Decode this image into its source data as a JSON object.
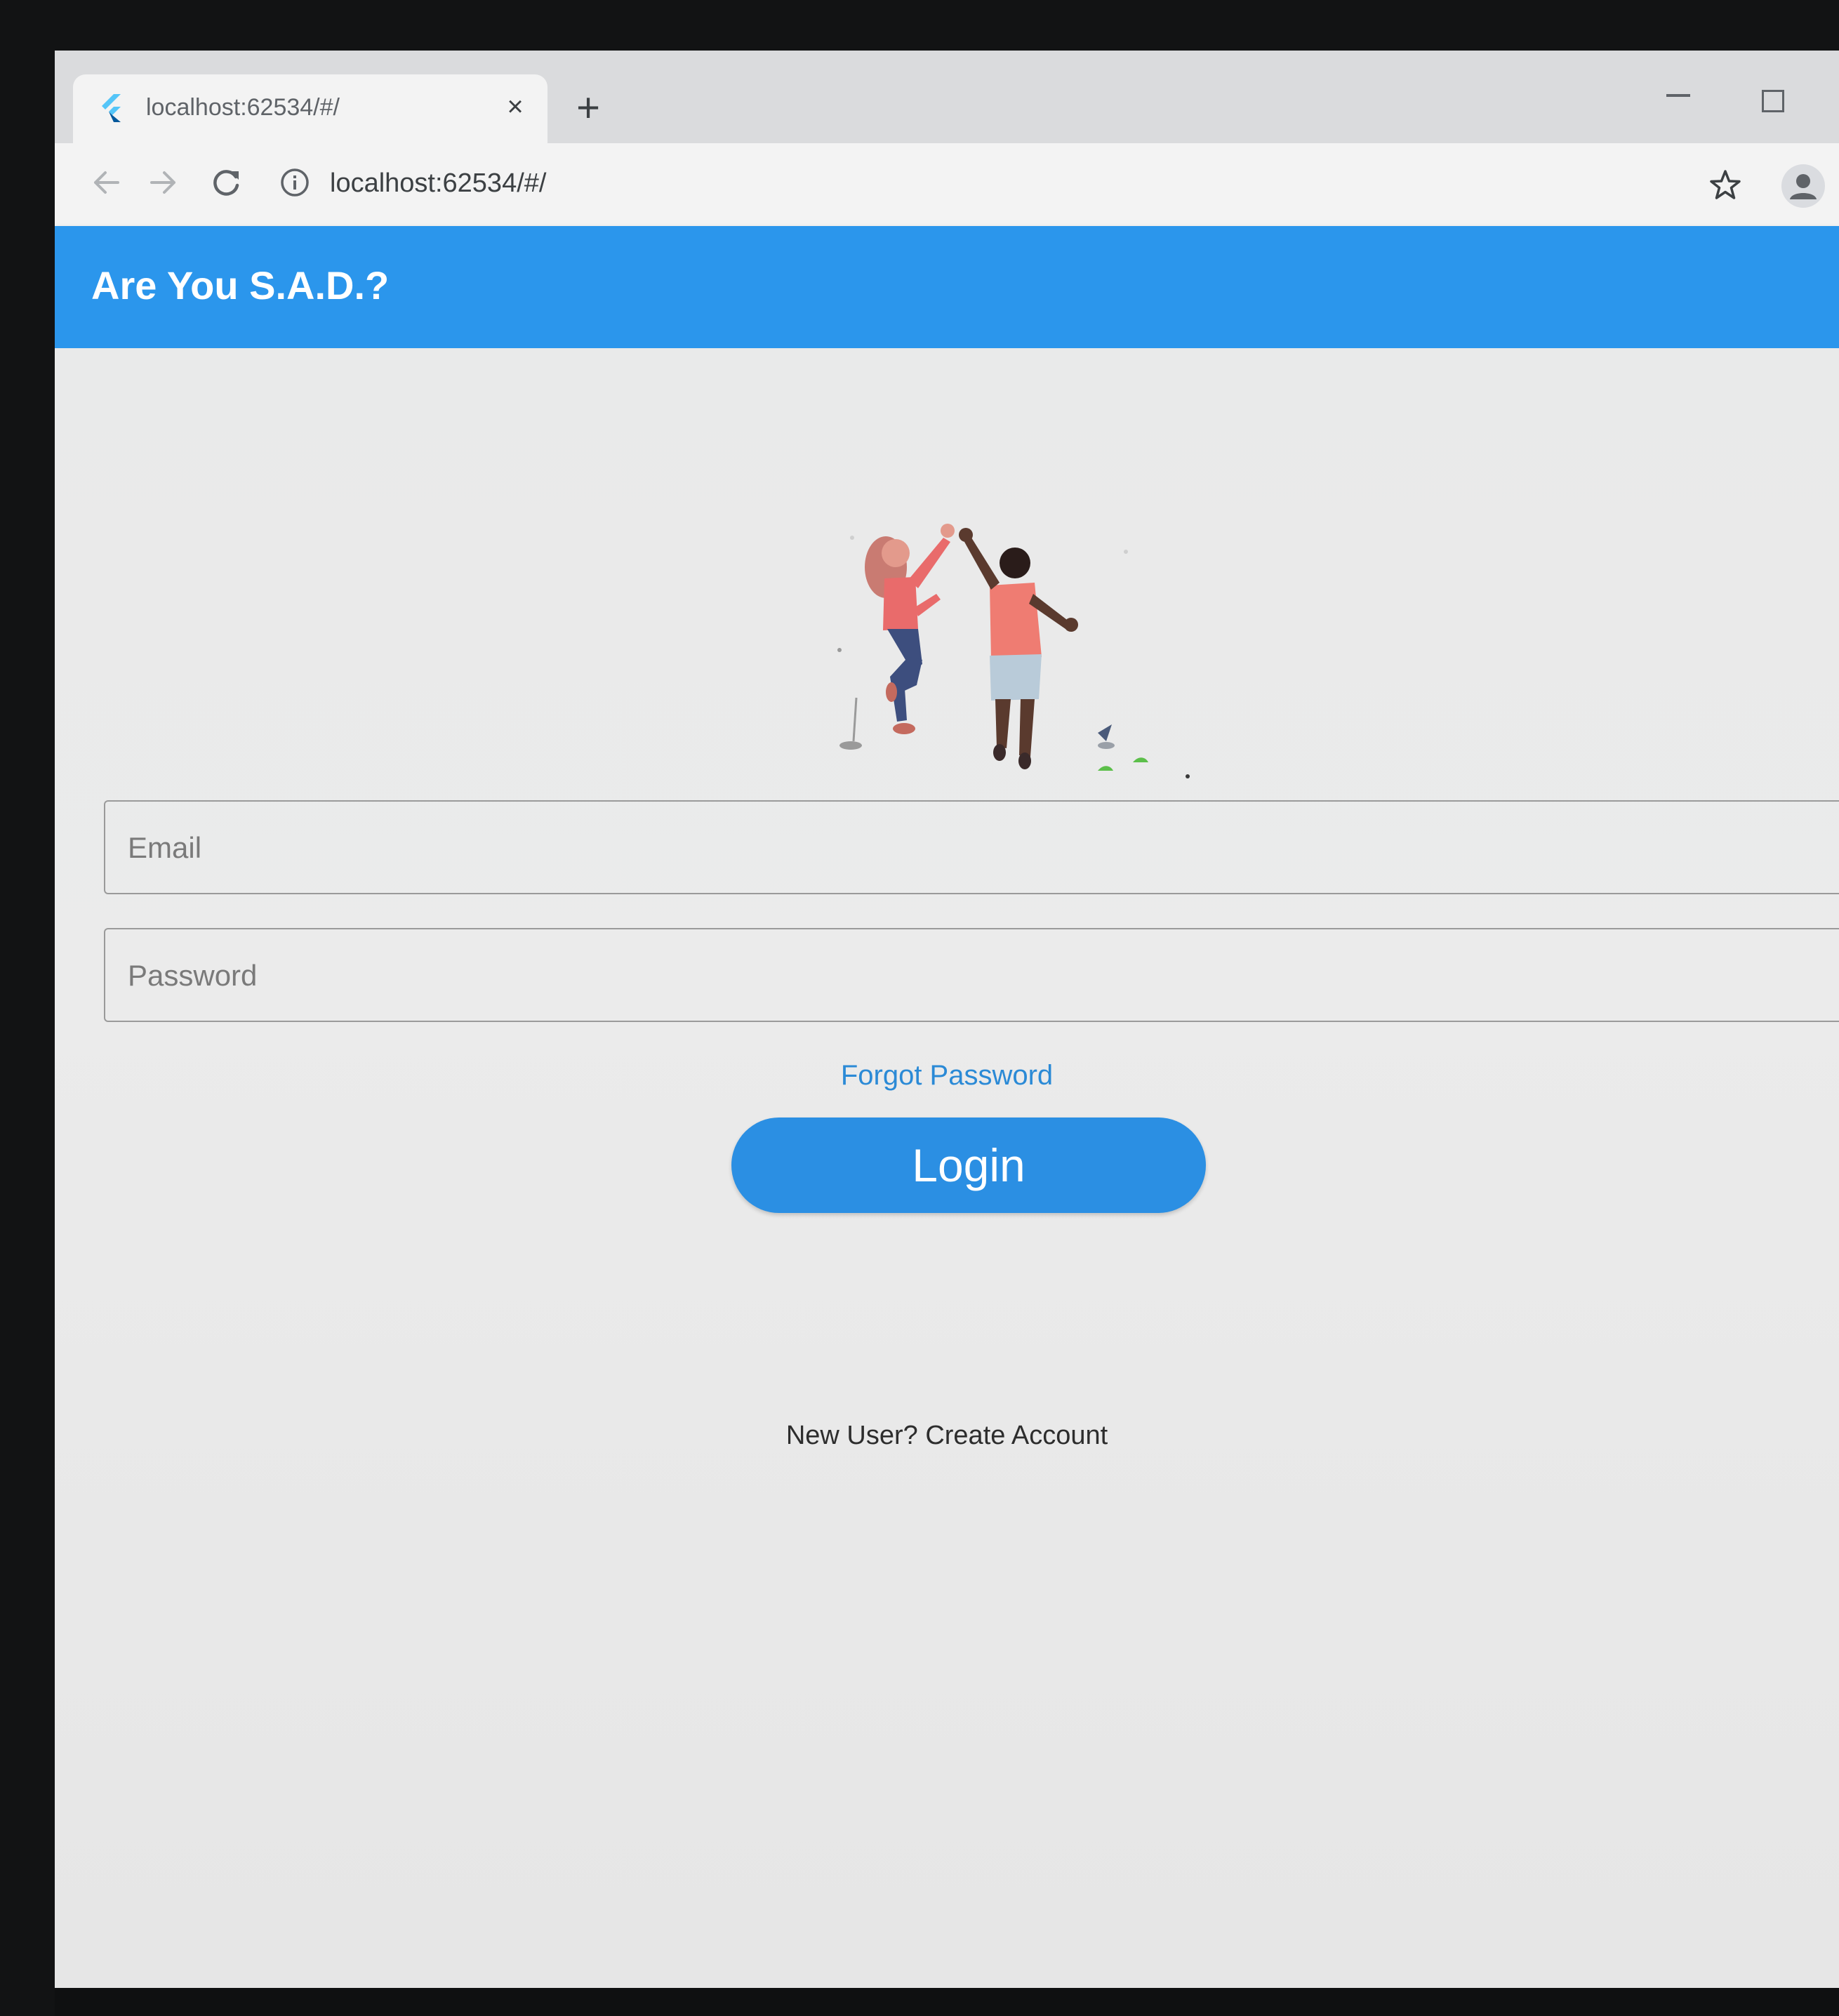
{
  "browser": {
    "tab_title": "localhost:62534/#/",
    "tab_close": "×",
    "new_tab": "+",
    "url": "localhost:62534/#/"
  },
  "app": {
    "title": "Are You S.A.D.?",
    "accent_color": "#2b96ec"
  },
  "login_form": {
    "email_placeholder": "Email",
    "password_placeholder": "Password",
    "forgot_password_label": "Forgot Password",
    "login_label": "Login",
    "create_account_label": "New User? Create Account",
    "link_color": "#2b8ad6"
  },
  "icons": {
    "favicon": "flutter-logo-icon",
    "back": "back-arrow-icon",
    "forward": "forward-arrow-icon",
    "reload": "reload-icon",
    "info": "info-icon",
    "bookmark": "star-icon",
    "profile": "profile-icon",
    "illustration": "high-five-illustration"
  }
}
